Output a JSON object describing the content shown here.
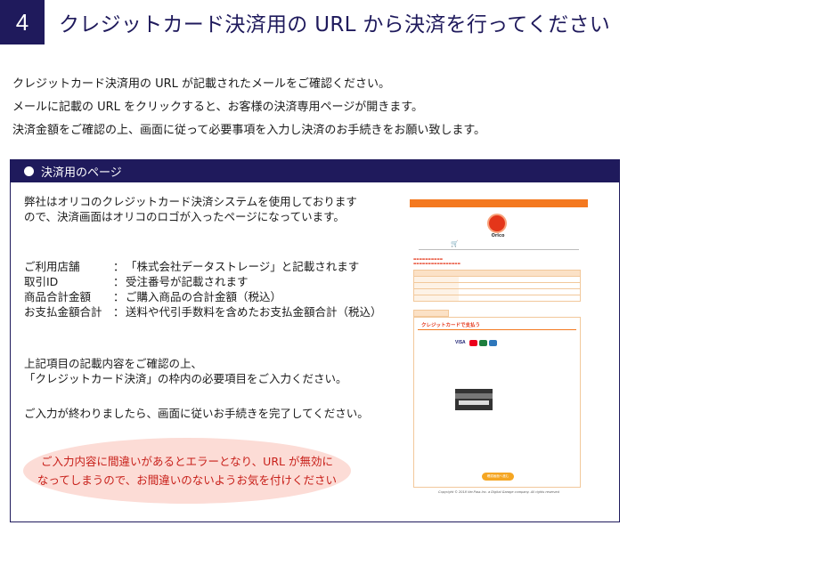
{
  "step": {
    "number": "4",
    "title": "クレジットカード決済用の URL から決済を行ってください"
  },
  "intro": {
    "line1": "クレジットカード決済用の URL が記載されたメールをご確認ください。",
    "line2": "メールに記載の URL をクリックすると、お客様の決済専用ページが開きます。",
    "line3": "決済金額をご確認の上、画面に従って必要事項を入力し決済のお手続きをお願い致します。"
  },
  "panel": {
    "title": "決済用のページ",
    "desc_line1": "弊社はオリコのクレジットカード決済システムを使用しております",
    "desc_line2": "ので、決済画面はオリコのロゴが入ったページになっています。",
    "separator": "：",
    "info": [
      {
        "label": "ご利用店舗",
        "value": "「株式会社データストレージ」と記載されます"
      },
      {
        "label": "取引ID",
        "value": "受注番号が記載されます"
      },
      {
        "label": "商品合計金額",
        "value": "ご購入商品の合計金額（税込）"
      },
      {
        "label": "お支払金額合計",
        "value": "送料や代引手数料を含めたお支払金額合計（税込）"
      }
    ],
    "note1_line1": "上記項目の記載内容をご確認の上、",
    "note1_line2": "「クレジットカード決済」の枠内の必要項目をご入力ください。",
    "note2": "ご入力が終わりましたら、画面に従いお手続きを完了してください。",
    "warning_line1": "ご入力内容に間違いがあるとエラーとなり、URL が無効に",
    "warning_line2": "なってしまうので、お間違いのないようお気を付けください"
  },
  "screenshot": {
    "brand": "Orico",
    "card_title": "クレジットカードで支払う",
    "visa": "VISA",
    "confirm": "確認画面へ進む",
    "copyright": "Copyright © 2018 Ver.Pass Inc. a Digital Garage company. All rights reserved"
  },
  "colors": {
    "navy": "#1f1a5c",
    "warning_red": "#c8201a",
    "warning_bg": "#fcdcd6",
    "orico_orange": "#f47920"
  }
}
